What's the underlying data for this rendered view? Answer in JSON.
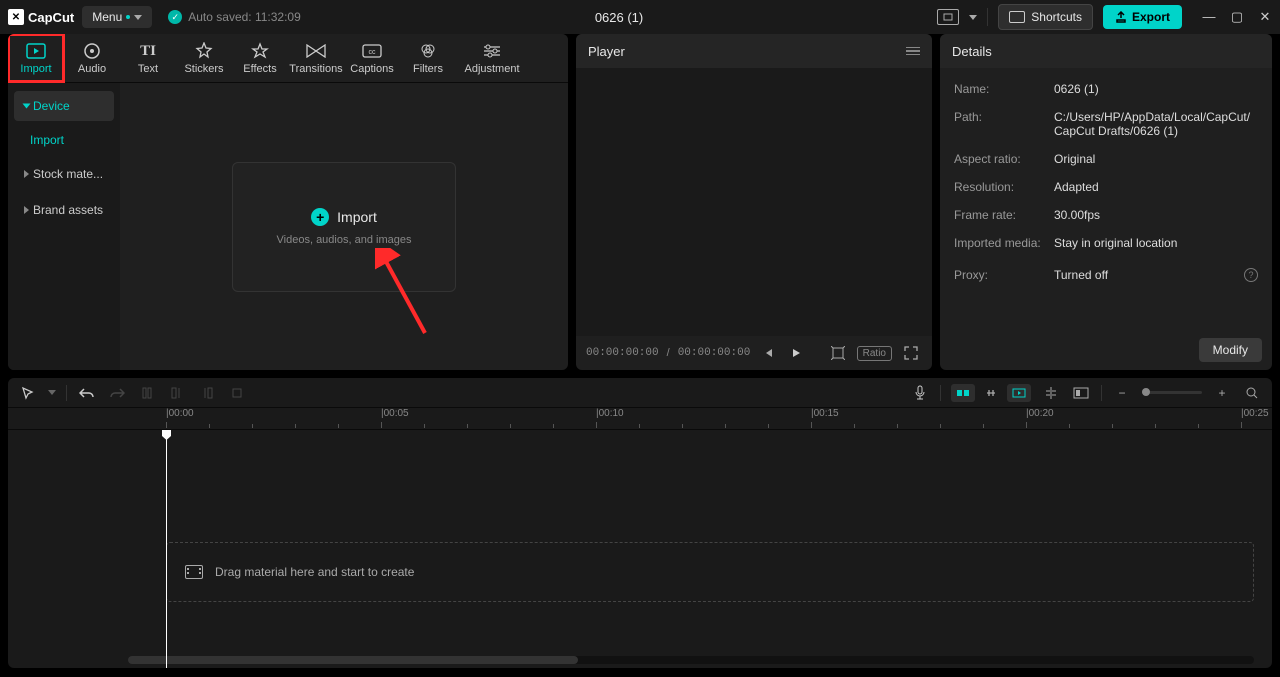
{
  "app": {
    "name": "CapCut"
  },
  "titlebar": {
    "menu": "Menu",
    "autosave": "Auto saved: 11:32:09",
    "project_title": "0626 (1)",
    "shortcuts": "Shortcuts",
    "export": "Export"
  },
  "tabs": {
    "import": "Import",
    "audio": "Audio",
    "text": "Text",
    "stickers": "Stickers",
    "effects": "Effects",
    "transitions": "Transitions",
    "captions": "Captions",
    "filters": "Filters",
    "adjustment": "Adjustment"
  },
  "sidenav": {
    "device": "Device",
    "import": "Import",
    "stock": "Stock mate...",
    "brand": "Brand assets"
  },
  "import_box": {
    "label": "Import",
    "sub": "Videos, audios, and images"
  },
  "player": {
    "title": "Player",
    "time_current": "00:00:00:00",
    "time_total": "00:00:00:00",
    "ratio": "Ratio"
  },
  "details": {
    "title": "Details",
    "rows": {
      "name_k": "Name:",
      "name_v": "0626 (1)",
      "path_k": "Path:",
      "path_v": "C:/Users/HP/AppData/Local/CapCut/CapCut Drafts/0626 (1)",
      "aspect_k": "Aspect ratio:",
      "aspect_v": "Original",
      "res_k": "Resolution:",
      "res_v": "Adapted",
      "fps_k": "Frame rate:",
      "fps_v": "30.00fps",
      "media_k": "Imported media:",
      "media_v": "Stay in original location",
      "proxy_k": "Proxy:",
      "proxy_v": "Turned off"
    },
    "modify": "Modify"
  },
  "timeline": {
    "ticks": [
      "00:00",
      "00:05",
      "00:10",
      "00:15",
      "00:20",
      "00:25"
    ],
    "drop_hint": "Drag material here and start to create"
  }
}
